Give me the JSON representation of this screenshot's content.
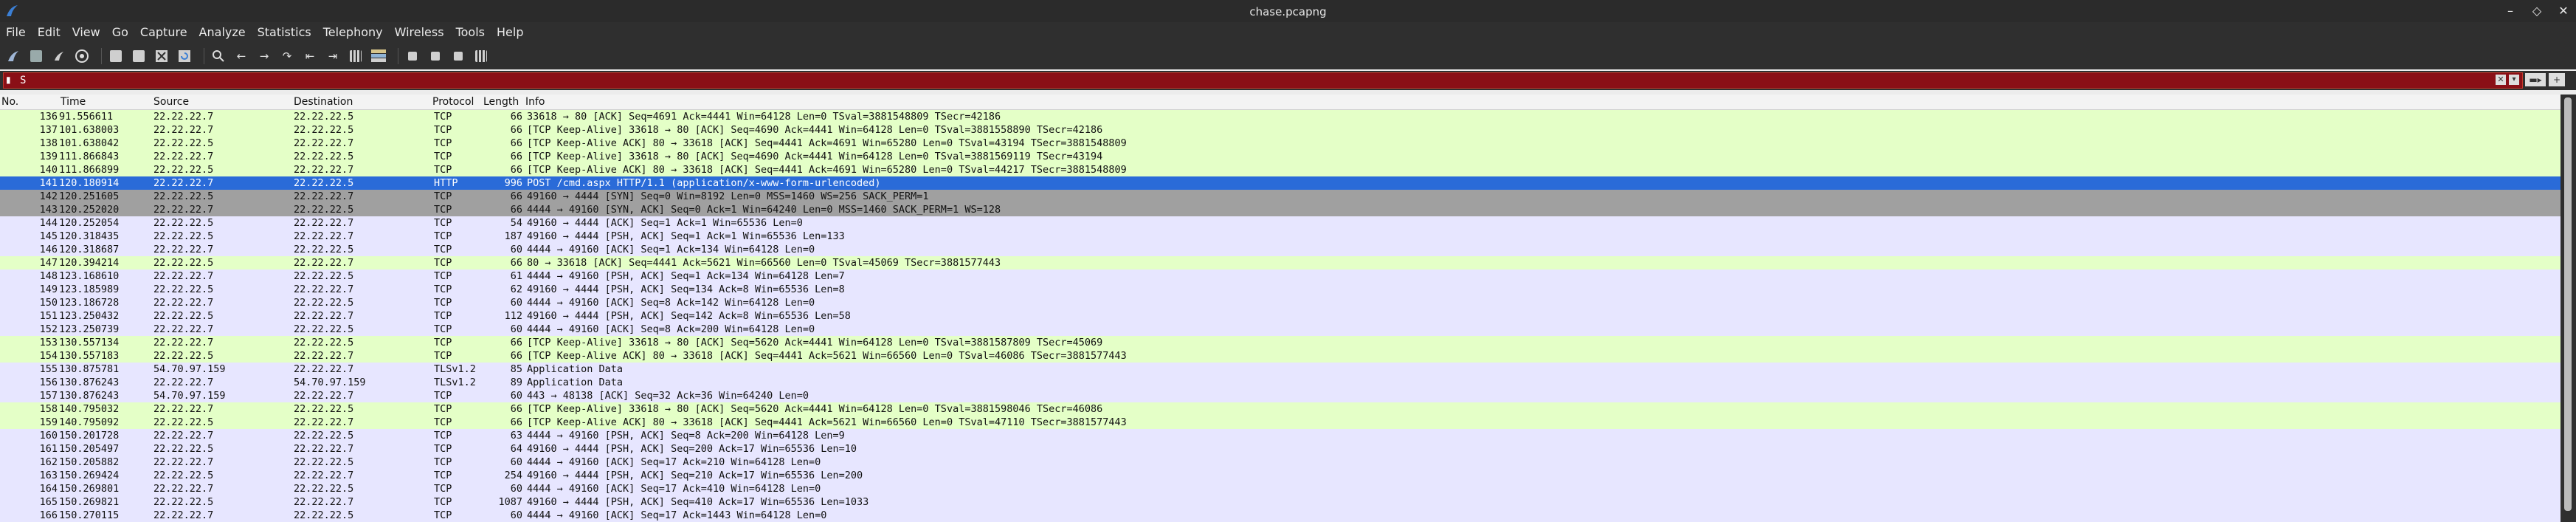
{
  "window": {
    "title": "chase.pcapng"
  },
  "menu": [
    "File",
    "Edit",
    "View",
    "Go",
    "Capture",
    "Analyze",
    "Statistics",
    "Telephony",
    "Wireless",
    "Tools",
    "Help"
  ],
  "toolbar": {
    "icons": [
      "shark-fin-start-icon",
      "stop-square-icon",
      "restart-capture-icon",
      "capture-options-gear-icon",
      "open-file-icon",
      "save-file-icon",
      "close-file-icon",
      "reload-file-icon",
      "find-packet-icon",
      "go-back-icon",
      "go-forward-icon",
      "go-to-packet-icon",
      "go-first-icon",
      "go-last-icon",
      "autoscroll-icon",
      "colorize-icon",
      "zoom-in-icon",
      "zoom-out-icon",
      "normal-size-icon",
      "resize-columns-icon"
    ]
  },
  "filter": {
    "value": "S",
    "bookmark_icon": "bookmark-icon",
    "clear_icon": "clear-x-icon",
    "dropdown_icon": "chevron-down-icon"
  },
  "columns": {
    "no": "No.",
    "time": "Time",
    "source": "Source",
    "destination": "Destination",
    "protocol": "Protocol",
    "length": "Length",
    "info": "Info"
  },
  "colors": {
    "row_green": "#e4ffc7",
    "row_blue": "#e7e6ff",
    "row_selected": "#2a6bd8",
    "row_gray": "#a0a0a0",
    "filter_invalid": "#8a0f16"
  },
  "packets": [
    {
      "no": "136",
      "time": "91.556611",
      "src": "22.22.22.7",
      "dst": "22.22.22.5",
      "proto": "TCP",
      "len": "66",
      "info": "33618 → 80 [ACK] Seq=4691 Ack=4441 Win=64128 Len=0 TSval=3881548809 TSecr=42186",
      "style": "green"
    },
    {
      "no": "137",
      "time": "101.638003",
      "src": "22.22.22.7",
      "dst": "22.22.22.5",
      "proto": "TCP",
      "len": "66",
      "info": "[TCP Keep-Alive] 33618 → 80 [ACK] Seq=4690 Ack=4441 Win=64128 Len=0 TSval=3881558890 TSecr=42186",
      "style": "green"
    },
    {
      "no": "138",
      "time": "101.638042",
      "src": "22.22.22.5",
      "dst": "22.22.22.7",
      "proto": "TCP",
      "len": "66",
      "info": "[TCP Keep-Alive ACK] 80 → 33618 [ACK] Seq=4441 Ack=4691 Win=65280 Len=0 TSval=43194 TSecr=3881548809",
      "style": "green"
    },
    {
      "no": "139",
      "time": "111.866843",
      "src": "22.22.22.7",
      "dst": "22.22.22.5",
      "proto": "TCP",
      "len": "66",
      "info": "[TCP Keep-Alive] 33618 → 80 [ACK] Seq=4690 Ack=4441 Win=64128 Len=0 TSval=3881569119 TSecr=43194",
      "style": "green"
    },
    {
      "no": "140",
      "time": "111.866899",
      "src": "22.22.22.5",
      "dst": "22.22.22.7",
      "proto": "TCP",
      "len": "66",
      "info": "[TCP Keep-Alive ACK] 80 → 33618 [ACK] Seq=4441 Ack=4691 Win=65280 Len=0 TSval=44217 TSecr=3881548809",
      "style": "green"
    },
    {
      "no": "141",
      "time": "120.180914",
      "src": "22.22.22.7",
      "dst": "22.22.22.5",
      "proto": "HTTP",
      "len": "996",
      "info": "POST /cmd.aspx HTTP/1.1  (application/x-www-form-urlencoded)",
      "style": "selected"
    },
    {
      "no": "142",
      "time": "120.251605",
      "src": "22.22.22.5",
      "dst": "22.22.22.7",
      "proto": "TCP",
      "len": "66",
      "info": "49160 → 4444 [SYN] Seq=0 Win=8192 Len=0 MSS=1460 WS=256 SACK_PERM=1",
      "style": "gray"
    },
    {
      "no": "143",
      "time": "120.252020",
      "src": "22.22.22.7",
      "dst": "22.22.22.5",
      "proto": "TCP",
      "len": "66",
      "info": "4444 → 49160 [SYN, ACK] Seq=0 Ack=1 Win=64240 Len=0 MSS=1460 SACK_PERM=1 WS=128",
      "style": "gray"
    },
    {
      "no": "144",
      "time": "120.252054",
      "src": "22.22.22.5",
      "dst": "22.22.22.7",
      "proto": "TCP",
      "len": "54",
      "info": "49160 → 4444 [ACK] Seq=1 Ack=1 Win=65536 Len=0",
      "style": "blue"
    },
    {
      "no": "145",
      "time": "120.318435",
      "src": "22.22.22.5",
      "dst": "22.22.22.7",
      "proto": "TCP",
      "len": "187",
      "info": "49160 → 4444 [PSH, ACK] Seq=1 Ack=1 Win=65536 Len=133",
      "style": "blue"
    },
    {
      "no": "146",
      "time": "120.318687",
      "src": "22.22.22.7",
      "dst": "22.22.22.5",
      "proto": "TCP",
      "len": "60",
      "info": "4444 → 49160 [ACK] Seq=1 Ack=134 Win=64128 Len=0",
      "style": "blue"
    },
    {
      "no": "147",
      "time": "120.394214",
      "src": "22.22.22.5",
      "dst": "22.22.22.7",
      "proto": "TCP",
      "len": "66",
      "info": "80 → 33618 [ACK] Seq=4441 Ack=5621 Win=66560 Len=0 TSval=45069 TSecr=3881577443",
      "style": "green"
    },
    {
      "no": "148",
      "time": "123.168610",
      "src": "22.22.22.7",
      "dst": "22.22.22.5",
      "proto": "TCP",
      "len": "61",
      "info": "4444 → 49160 [PSH, ACK] Seq=1 Ack=134 Win=64128 Len=7",
      "style": "blue"
    },
    {
      "no": "149",
      "time": "123.185989",
      "src": "22.22.22.5",
      "dst": "22.22.22.7",
      "proto": "TCP",
      "len": "62",
      "info": "49160 → 4444 [PSH, ACK] Seq=134 Ack=8 Win=65536 Len=8",
      "style": "blue"
    },
    {
      "no": "150",
      "time": "123.186728",
      "src": "22.22.22.7",
      "dst": "22.22.22.5",
      "proto": "TCP",
      "len": "60",
      "info": "4444 → 49160 [ACK] Seq=8 Ack=142 Win=64128 Len=0",
      "style": "blue"
    },
    {
      "no": "151",
      "time": "123.250432",
      "src": "22.22.22.5",
      "dst": "22.22.22.7",
      "proto": "TCP",
      "len": "112",
      "info": "49160 → 4444 [PSH, ACK] Seq=142 Ack=8 Win=65536 Len=58",
      "style": "blue"
    },
    {
      "no": "152",
      "time": "123.250739",
      "src": "22.22.22.7",
      "dst": "22.22.22.5",
      "proto": "TCP",
      "len": "60",
      "info": "4444 → 49160 [ACK] Seq=8 Ack=200 Win=64128 Len=0",
      "style": "blue"
    },
    {
      "no": "153",
      "time": "130.557134",
      "src": "22.22.22.7",
      "dst": "22.22.22.5",
      "proto": "TCP",
      "len": "66",
      "info": "[TCP Keep-Alive] 33618 → 80 [ACK] Seq=5620 Ack=4441 Win=64128 Len=0 TSval=3881587809 TSecr=45069",
      "style": "green"
    },
    {
      "no": "154",
      "time": "130.557183",
      "src": "22.22.22.5",
      "dst": "22.22.22.7",
      "proto": "TCP",
      "len": "66",
      "info": "[TCP Keep-Alive ACK] 80 → 33618 [ACK] Seq=4441 Ack=5621 Win=66560 Len=0 TSval=46086 TSecr=3881577443",
      "style": "green"
    },
    {
      "no": "155",
      "time": "130.875781",
      "src": "54.70.97.159",
      "dst": "22.22.22.7",
      "proto": "TLSv1.2",
      "len": "85",
      "info": "Application Data",
      "style": "blue"
    },
    {
      "no": "156",
      "time": "130.876243",
      "src": "22.22.22.7",
      "dst": "54.70.97.159",
      "proto": "TLSv1.2",
      "len": "89",
      "info": "Application Data",
      "style": "blue"
    },
    {
      "no": "157",
      "time": "130.876243",
      "src": "54.70.97.159",
      "dst": "22.22.22.7",
      "proto": "TCP",
      "len": "60",
      "info": "443 → 48138 [ACK] Seq=32 Ack=36 Win=64240 Len=0",
      "style": "blue"
    },
    {
      "no": "158",
      "time": "140.795032",
      "src": "22.22.22.7",
      "dst": "22.22.22.5",
      "proto": "TCP",
      "len": "66",
      "info": "[TCP Keep-Alive] 33618 → 80 [ACK] Seq=5620 Ack=4441 Win=64128 Len=0 TSval=3881598046 TSecr=46086",
      "style": "green"
    },
    {
      "no": "159",
      "time": "140.795092",
      "src": "22.22.22.5",
      "dst": "22.22.22.7",
      "proto": "TCP",
      "len": "66",
      "info": "[TCP Keep-Alive ACK] 80 → 33618 [ACK] Seq=4441 Ack=5621 Win=66560 Len=0 TSval=47110 TSecr=3881577443",
      "style": "green"
    },
    {
      "no": "160",
      "time": "150.201728",
      "src": "22.22.22.7",
      "dst": "22.22.22.5",
      "proto": "TCP",
      "len": "63",
      "info": "4444 → 49160 [PSH, ACK] Seq=8 Ack=200 Win=64128 Len=9",
      "style": "blue"
    },
    {
      "no": "161",
      "time": "150.205497",
      "src": "22.22.22.5",
      "dst": "22.22.22.7",
      "proto": "TCP",
      "len": "64",
      "info": "49160 → 4444 [PSH, ACK] Seq=200 Ack=17 Win=65536 Len=10",
      "style": "blue"
    },
    {
      "no": "162",
      "time": "150.205882",
      "src": "22.22.22.7",
      "dst": "22.22.22.5",
      "proto": "TCP",
      "len": "60",
      "info": "4444 → 49160 [ACK] Seq=17 Ack=210 Win=64128 Len=0",
      "style": "blue"
    },
    {
      "no": "163",
      "time": "150.269424",
      "src": "22.22.22.5",
      "dst": "22.22.22.7",
      "proto": "TCP",
      "len": "254",
      "info": "49160 → 4444 [PSH, ACK] Seq=210 Ack=17 Win=65536 Len=200",
      "style": "blue"
    },
    {
      "no": "164",
      "time": "150.269801",
      "src": "22.22.22.7",
      "dst": "22.22.22.5",
      "proto": "TCP",
      "len": "60",
      "info": "4444 → 49160 [ACK] Seq=17 Ack=410 Win=64128 Len=0",
      "style": "blue"
    },
    {
      "no": "165",
      "time": "150.269821",
      "src": "22.22.22.5",
      "dst": "22.22.22.7",
      "proto": "TCP",
      "len": "1087",
      "info": "49160 → 4444 [PSH, ACK] Seq=410 Ack=17 Win=65536 Len=1033",
      "style": "blue"
    },
    {
      "no": "166",
      "time": "150.270115",
      "src": "22.22.22.7",
      "dst": "22.22.22.5",
      "proto": "TCP",
      "len": "60",
      "info": "4444 → 49160 [ACK] Seq=17 Ack=1443 Win=64128 Len=0",
      "style": "blue"
    }
  ]
}
